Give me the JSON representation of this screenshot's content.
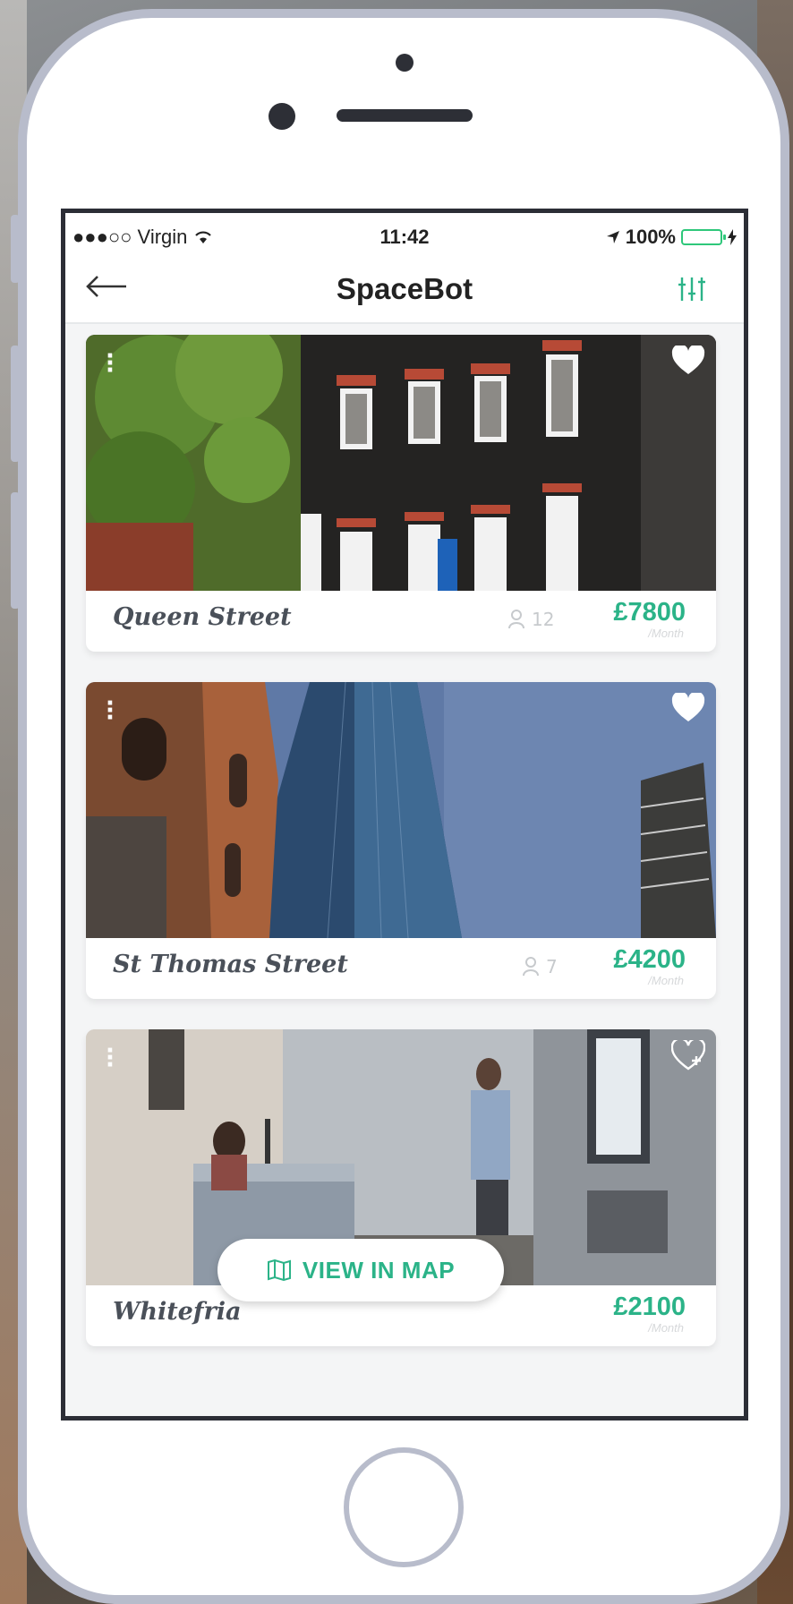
{
  "status_bar": {
    "carrier": "●●●○○ Virgin",
    "time": "11:42",
    "battery": "100%",
    "battery_level": 1.0
  },
  "nav": {
    "back_icon": "arrow-left-icon",
    "title": "SpaceBot",
    "filter_icon": "sliders-icon"
  },
  "colors": {
    "accent": "#2bb388",
    "text_dark": "#4a5059",
    "frame": "#b8bccb"
  },
  "listings": [
    {
      "name": "Queen Street",
      "capacity": "12",
      "price": "£7800",
      "period": "/Month",
      "favorited": true
    },
    {
      "name": "St Thomas Street",
      "capacity": "7",
      "price": "£4200",
      "period": "/Month",
      "favorited": true
    },
    {
      "name": "Whitefria",
      "capacity": "",
      "price": "£2100",
      "period": "/Month",
      "favorited": false
    }
  ],
  "map_button": {
    "label": "VIEW IN MAP",
    "icon": "map-icon"
  }
}
